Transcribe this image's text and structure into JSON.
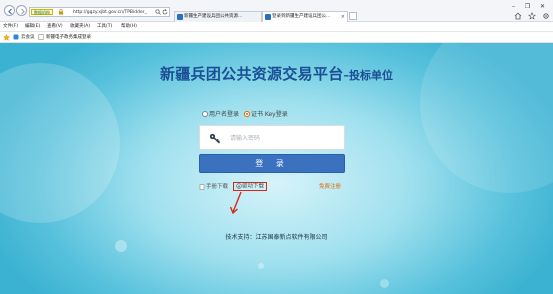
{
  "browser": {
    "cert_label": "数据机构",
    "address_url": "http://ggzy.xjbt.gov.cn/TPBidder_",
    "tabs": [
      {
        "label": "新疆生产建设兵团公共资源..."
      },
      {
        "label": "登录到新疆生产建设兵团公..."
      }
    ],
    "window_controls": {
      "minimize": "–",
      "maximize": "❐",
      "close": "✕"
    },
    "menu": [
      {
        "label": "文件(F)"
      },
      {
        "label": "编辑(E)"
      },
      {
        "label": "查看(V)"
      },
      {
        "label": "收藏夹(A)"
      },
      {
        "label": "工具(T)"
      },
      {
        "label": "帮助(H)"
      }
    ],
    "favorites": [
      {
        "label": "云会议"
      },
      {
        "label": "新疆电子政务集成登录"
      }
    ]
  },
  "page": {
    "title": "新疆兵团公共资源交易平台",
    "subtitle": "–投标单位",
    "login_options": {
      "username_login": "用户名登录",
      "cert_key_login": "证书 Key登录",
      "selected": "cert_key_login"
    },
    "pin_placeholder": "请输入密码",
    "login_button": "登 录",
    "links": {
      "manual_download": "手册下载",
      "driver_download": "驱动下载",
      "free_register": "免费注册"
    },
    "tech_support": "技术支持：江苏国泰新点软件有限公司"
  },
  "colors": {
    "title": "#1a4f94",
    "login_button": "#3a72c0",
    "register_link": "#e06800",
    "highlight_box": "#d8261b",
    "background": "#57c1dc"
  }
}
